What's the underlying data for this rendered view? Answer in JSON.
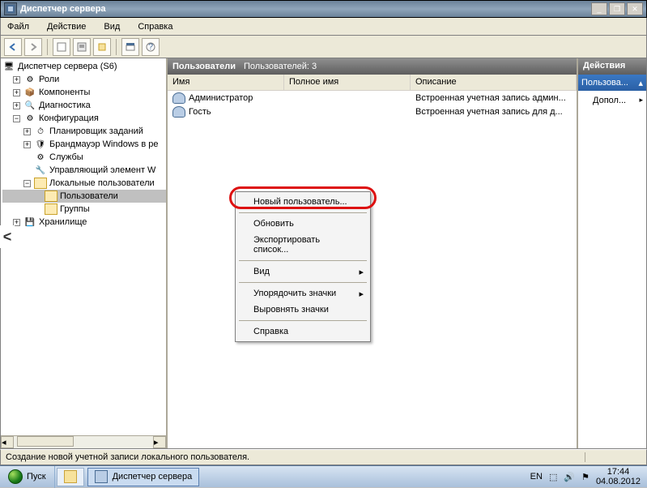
{
  "window": {
    "title": "Диспетчер сервера"
  },
  "menu": {
    "file": "Файл",
    "action": "Действие",
    "view": "Вид",
    "help": "Справка"
  },
  "tree": {
    "root": "Диспетчер сервера (S6)",
    "roles": "Роли",
    "components": "Компоненты",
    "diagnostics": "Диагностика",
    "configuration": "Конфигурация",
    "task_scheduler": "Планировщик заданий",
    "firewall": "Брандмауэр Windows в ре",
    "services": "Службы",
    "wmi": "Управляющий элемент W",
    "local_users": "Локальные пользователи",
    "users": "Пользователи",
    "groups": "Группы",
    "storage": "Хранилище"
  },
  "grid": {
    "title": "Пользователи",
    "subtitle": "Пользователей: 3",
    "col_name": "Имя",
    "col_fullname": "Полное имя",
    "col_desc": "Описание",
    "rows": [
      {
        "name": "Администратор",
        "full": "",
        "desc": "Встроенная учетная запись админ..."
      },
      {
        "name": "Гость",
        "full": "",
        "desc": "Встроенная учетная запись для д..."
      }
    ]
  },
  "context_menu": {
    "new_user": "Новый пользователь...",
    "refresh": "Обновить",
    "export": "Экспортировать список...",
    "view": "Вид",
    "arrange": "Упорядочить значки",
    "align": "Выровнять значки",
    "help": "Справка"
  },
  "actions": {
    "header": "Действия",
    "section": "Пользова...",
    "more": "Допол..."
  },
  "status": {
    "text": "Создание новой учетной записи локального пользователя."
  },
  "taskbar": {
    "start": "Пуск",
    "app": "Диспетчер сервера",
    "lang": "EN",
    "time": "17:44",
    "date": "04.08.2012"
  }
}
